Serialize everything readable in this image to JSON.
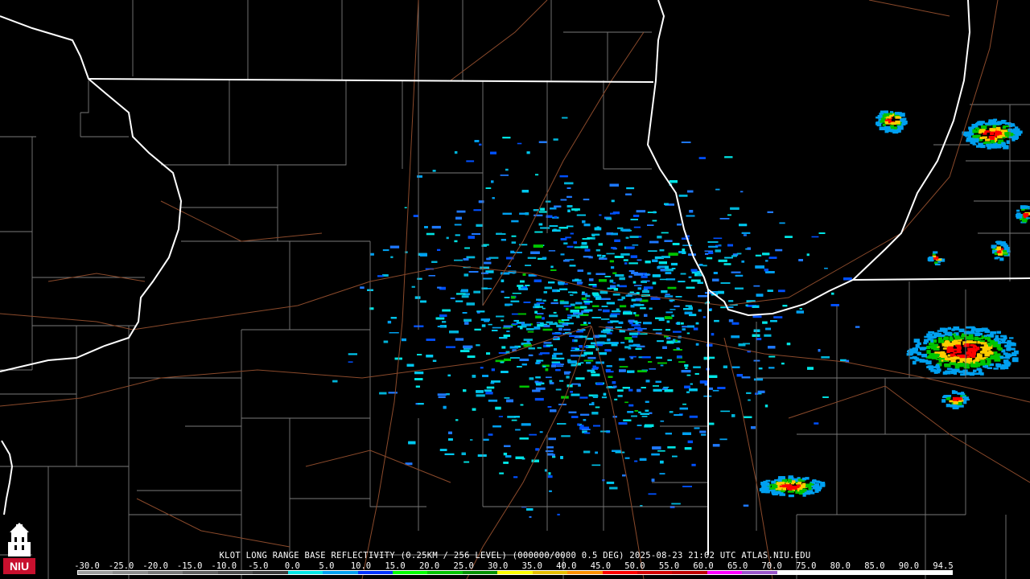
{
  "title": "KLOT LONG RANGE BASE REFLECTIVITY (0.25KM / 256 LEVEL) (000000/0000 0.5 DEG) 2025-08-23 21:02 UTC  ATLAS.NIU.EDU",
  "logo": {
    "text": "NIU",
    "icon": "university-tower-icon",
    "color": "#c8102e"
  },
  "legend": {
    "ticks": [
      "-30.0",
      "-25.0",
      "-20.0",
      "-15.0",
      "-10.0",
      "-5.0",
      "0.0",
      "5.0",
      "10.0",
      "15.0",
      "20.0",
      "25.0",
      "30.0",
      "35.0",
      "40.0",
      "45.0",
      "50.0",
      "55.0",
      "60.0",
      "65.0",
      "70.0",
      "75.0",
      "80.0",
      "85.0",
      "90.0",
      "94.5"
    ],
    "colors": [
      "#9c9c9c",
      "#8a8a8a",
      "#767676",
      "#5e5e5e",
      "#4a4a4a",
      "#383838",
      "#00e4e4",
      "#00a0f0",
      "#0033ff",
      "#00ff00",
      "#00c400",
      "#009000",
      "#ffff00",
      "#e6be00",
      "#ff9000",
      "#ff0000",
      "#d40000",
      "#be0000",
      "#ff00ff",
      "#9955c9",
      "#ffffff",
      "#ffffff",
      "#ffffff",
      "#ffffff",
      "#ffffff"
    ]
  },
  "colors": {
    "state_border": "#ffffff",
    "county_line": "#7a7a7a",
    "highway": "#8b4a2b",
    "background": "#000000"
  }
}
